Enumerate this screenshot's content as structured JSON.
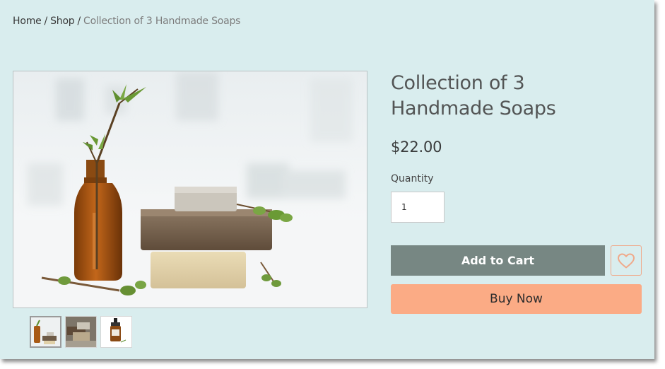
{
  "breadcrumb": {
    "home": "Home",
    "separator": "/",
    "shop": "Shop",
    "current": "Collection of 3 Handmade Soaps"
  },
  "product": {
    "title": "Collection of 3 Handmade Soaps",
    "price": "$22.00",
    "quantity_label": "Quantity",
    "quantity_value": "1"
  },
  "actions": {
    "add_to_cart": "Add to Cart",
    "buy_now": "Buy Now",
    "wishlist_icon": "heart-icon"
  },
  "images": {
    "main": "amber bottle with sprigs and stacked soap bars",
    "thumbnails": [
      "bottle-and-soaps",
      "soap-stack",
      "dispenser-bottle"
    ]
  },
  "colors": {
    "page_bg": "#d9edee",
    "add_to_cart_bg": "#778783",
    "buy_now_bg": "#fbab85",
    "wishlist_border": "#f0a98a"
  }
}
